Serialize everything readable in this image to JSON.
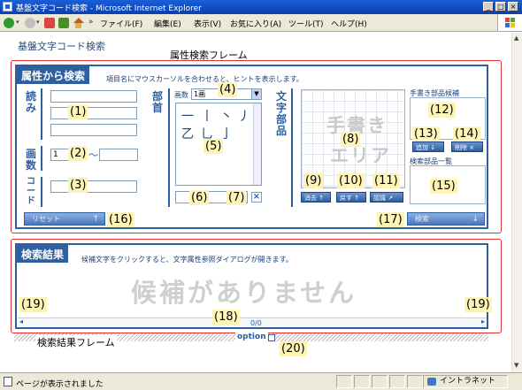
{
  "window": {
    "title": "基盤文字コード検索 - Microsoft Internet Explorer",
    "min": "_",
    "max": "□",
    "close": "×"
  },
  "menu": {
    "chevron": "»",
    "items": [
      "ファイル(F)",
      "編集(E)",
      "表示(V)",
      "お気に入り(A)",
      "ツール(T)",
      "ヘルプ(H)"
    ]
  },
  "page": {
    "app_title": "基盤文字コード検索",
    "frame_attr_label": "属性検索フレーム",
    "frame_result_label": "検索結果フレーム"
  },
  "attr_panel": {
    "title": "属性から検索",
    "hint": "項目名にマウスカーソルを合わせると、ヒントを表示します。",
    "reading_label": "読み",
    "strokes_label": "画数",
    "code_label": "コード",
    "strokes_from": "1",
    "range_sep": "〜",
    "radical_label": "部首",
    "stroke_count_label": "画数",
    "stroke_select": "1画",
    "radicals": [
      "一",
      "丨",
      "丶",
      "丿",
      "乙",
      "乚",
      "亅"
    ],
    "char_parts_label": "文字部品",
    "handwrite_text": [
      "手書き",
      "エリア"
    ],
    "erase_btn": "消去",
    "undo_btn": "戻す",
    "confirm_btn": "認識",
    "candidates_label": "手書き部品候補",
    "add_btn": "追加",
    "delete_btn": "削除",
    "parts_list_label": "検索部品一覧",
    "reset_btn": "リセット",
    "search_btn": "検索",
    "arrow_up": "↑",
    "arrow_down": "↓",
    "clear_x": "×"
  },
  "result_panel": {
    "title": "検索結果",
    "hint": "候補文字をクリックすると、文字属性参照ダイアログが開きます。",
    "empty_text": "候補がありません",
    "counter": "0/0",
    "left_arrow": "◂",
    "right_arrow": "▸"
  },
  "option": {
    "label": "option"
  },
  "markers": {
    "m1": "(1)",
    "m2": "(2)",
    "m3": "(3)",
    "m4": "(4)",
    "m5": "(5)",
    "m6": "(6)",
    "m7": "(7)",
    "m8": "(8)",
    "m9": "(9)",
    "m10": "(10)",
    "m11": "(11)",
    "m12": "(12)",
    "m13": "(13)",
    "m14": "(14)",
    "m15": "(15)",
    "m16": "(16)",
    "m17": "(17)",
    "m18": "(18)",
    "m19": "(19)",
    "m20": "(20)"
  },
  "statusbar": {
    "message": "ページが表示されました",
    "zone": "イントラネット"
  },
  "colors": {
    "panel_blue": "#2e5fa0",
    "frame_red": "#e03030",
    "marker_yellow": "#fff4b8"
  }
}
